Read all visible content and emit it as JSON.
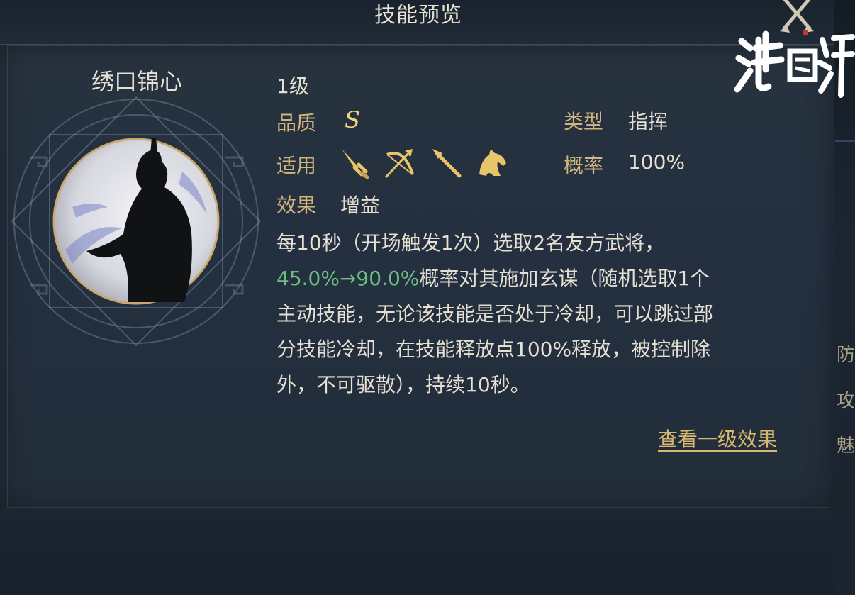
{
  "header": {
    "title": "技能预览"
  },
  "skill": {
    "name": "绣口锦心",
    "level": "1级",
    "quality_label": "品质",
    "quality_value": "S",
    "applicable_label": "适用",
    "applicable_icons": [
      "sword-icon",
      "bow-icon",
      "spear-icon",
      "horse-icon"
    ],
    "effect_label": "效果",
    "effect_value": "增益",
    "type_label": "类型",
    "type_value": "指挥",
    "rate_label": "概率",
    "rate_value": "100%",
    "description": {
      "line1": "每10秒（开场触发1次）选取2名友方武将，",
      "highlight": "45.0%→90.0%",
      "line2_rest": "概率对其施加玄谋（随机选取1个",
      "line3": "主动技能，无论该技能是否处于冷却，可以跳过部",
      "line4": "分技能冷却，在技能释放点100%释放，被控制除",
      "line5": "外，不可驱散），持续10秒。"
    },
    "view_link": "查看一级效果"
  },
  "side_panel": {
    "chars": [
      "防",
      "攻",
      "魅"
    ]
  },
  "watermark": "鸿图评",
  "colors": {
    "gold": "#d2b57e",
    "highlight_green": "#6cbf7f",
    "panel": "#243040"
  }
}
